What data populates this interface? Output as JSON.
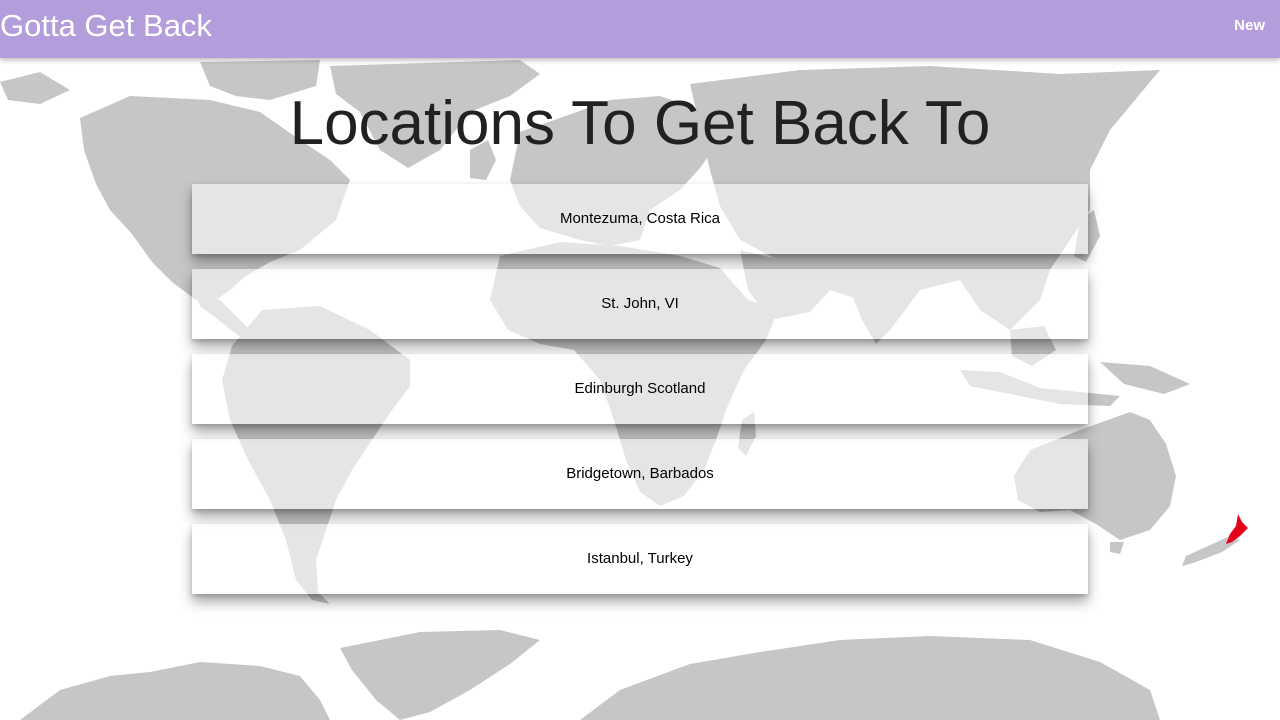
{
  "app": {
    "title": "Gotta Get Back",
    "nav_new_label": "New"
  },
  "main": {
    "heading": "Locations To Get Back To",
    "locations": [
      {
        "label": "Montezuma, Costa Rica"
      },
      {
        "label": "St. John, VI"
      },
      {
        "label": "Edinburgh Scotland"
      },
      {
        "label": "Bridgetown, Barbados"
      },
      {
        "label": "Istanbul, Turkey"
      }
    ]
  },
  "background": {
    "icon": "world-map",
    "land_color": "#c6c6c6",
    "highlight_color": "#e3001b"
  },
  "colors": {
    "navbar": "#b39ddb",
    "navbar_text": "#ffffff",
    "heading_text": "#212121",
    "card_text": "#000000"
  }
}
